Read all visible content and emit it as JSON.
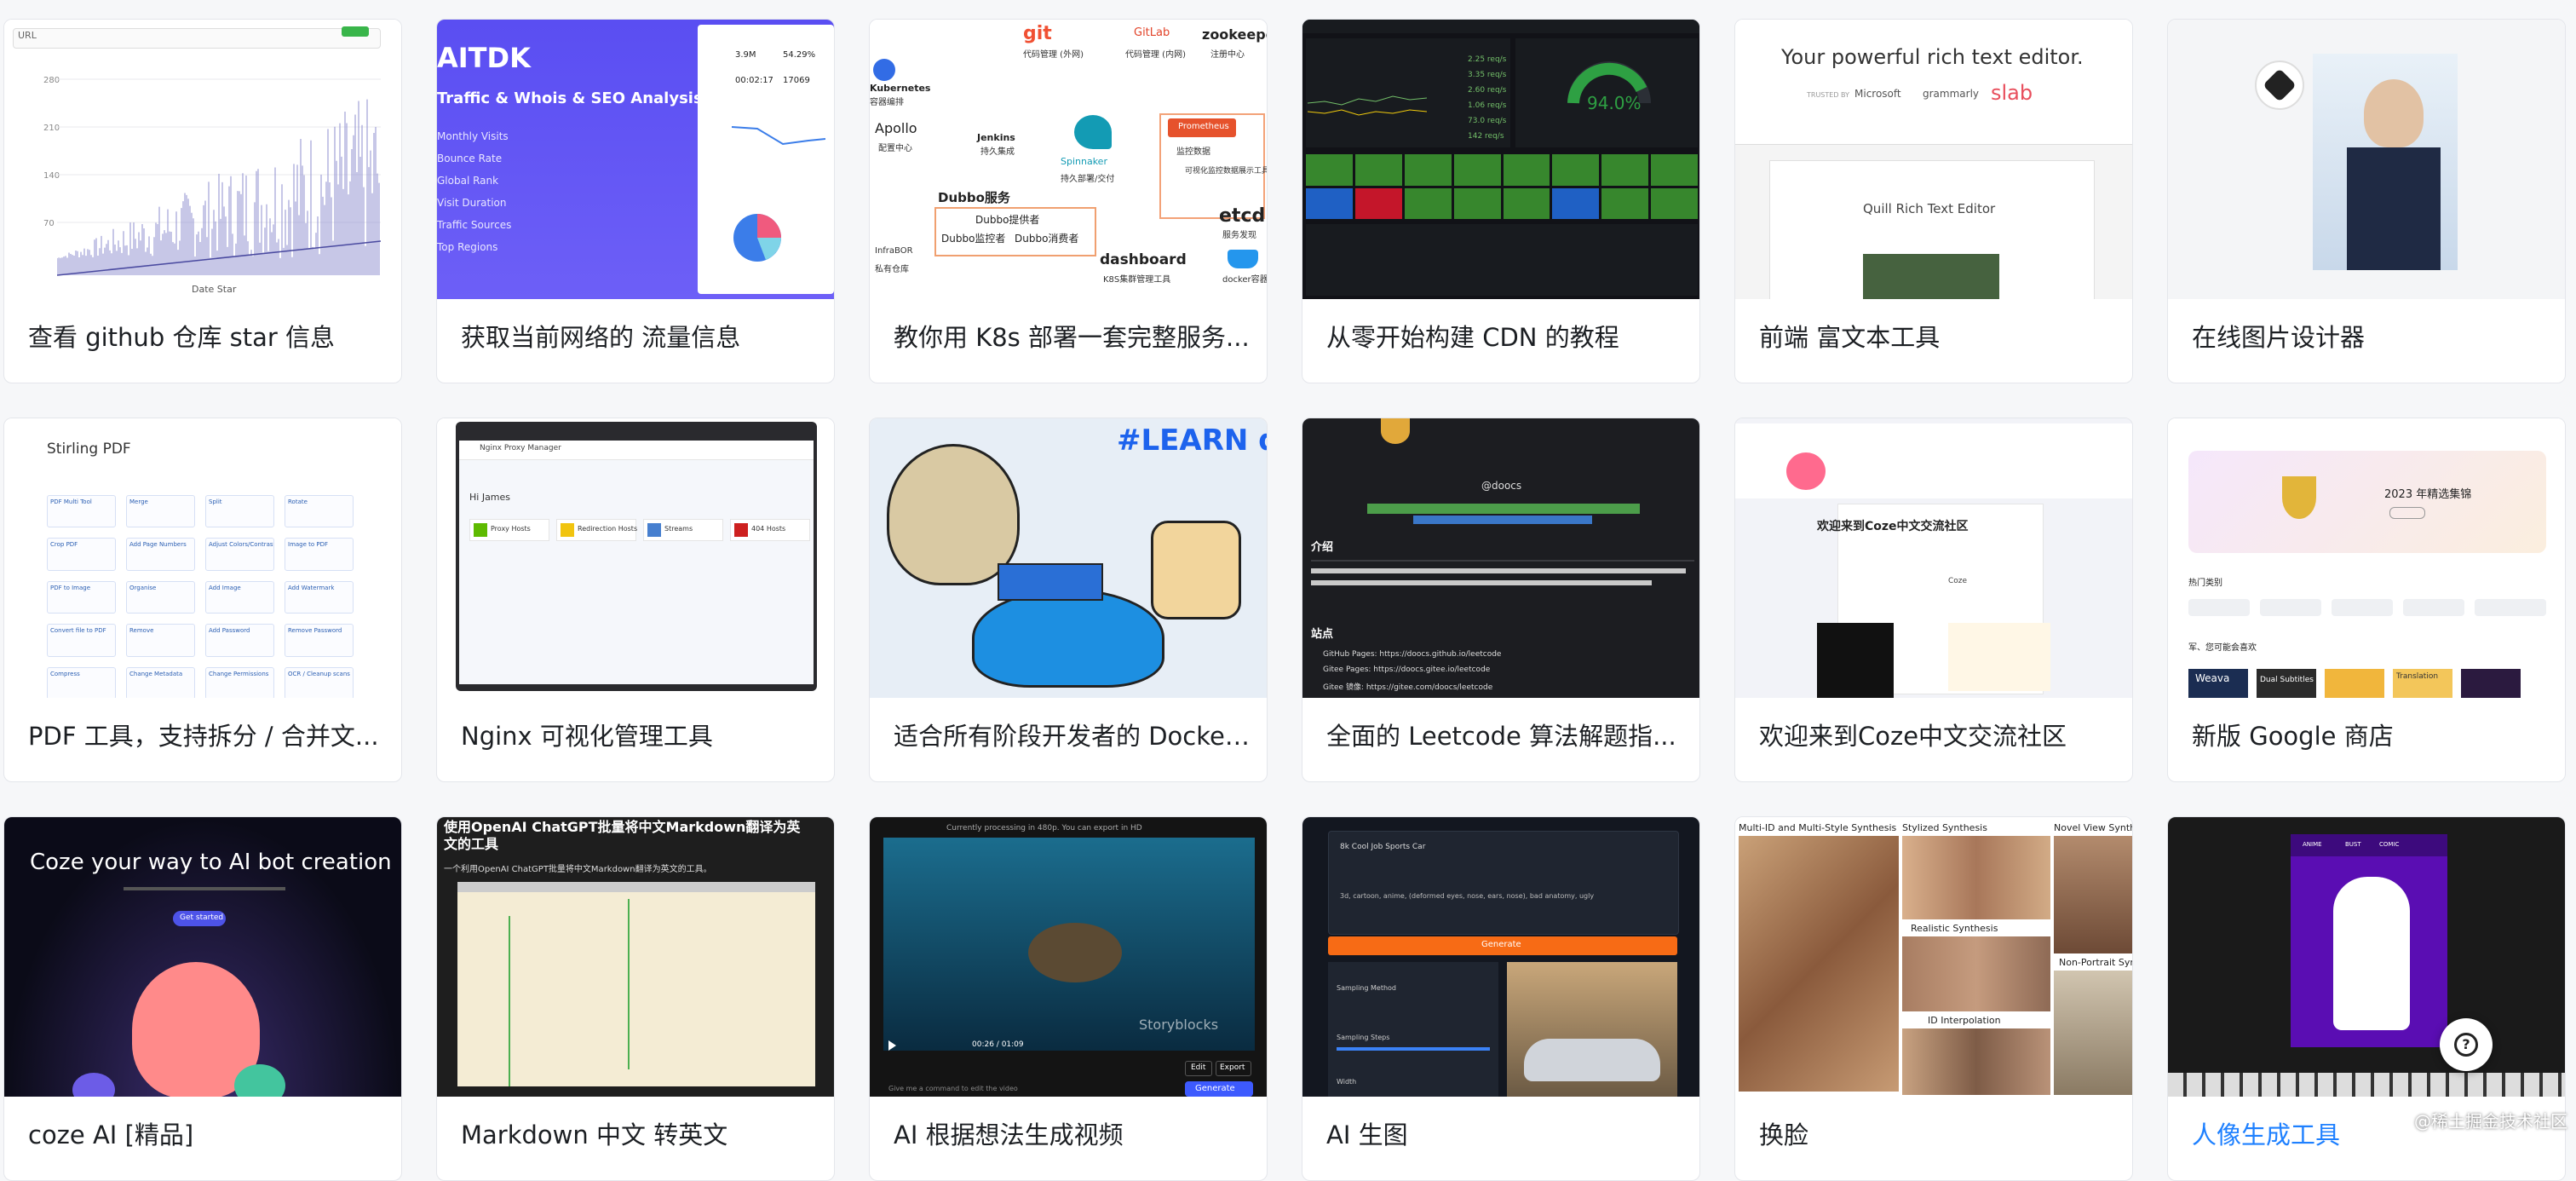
{
  "cards": [
    {
      "title": "查看 github 仓库 star 信息"
    },
    {
      "title": "获取当前网络的 流量信息"
    },
    {
      "title": "教你用 K8s 部署一套完整服务..."
    },
    {
      "title": "从零开始构建 CDN 的教程"
    },
    {
      "title": "前端 富文本工具"
    },
    {
      "title": "在线图片设计器"
    },
    {
      "title": "PDF 工具，支持拆分 / 合并文..."
    },
    {
      "title": "Nginx 可视化管理工具"
    },
    {
      "title": "适合所有阶段开发者的 Docker..."
    },
    {
      "title": "全面的 Leetcode 算法解题指..."
    },
    {
      "title": "欢迎来到Coze中文交流社区"
    },
    {
      "title": "新版 Google 商店"
    },
    {
      "title": "coze AI [精品]"
    },
    {
      "title": "Markdown 中文 转英文"
    },
    {
      "title": "AI 根据想法生成视频"
    },
    {
      "title": "AI 生图"
    },
    {
      "title": "换脸"
    },
    {
      "title": "人像生成工具"
    }
  ],
  "thumbs": {
    "github_star": {
      "url_label": "URL",
      "legend": "Date  Star",
      "y_ticks": [
        "280",
        "210",
        "140",
        "70"
      ]
    },
    "aitdk": {
      "brand": "AITDK",
      "heading": "Traffic & Whois & SEO Analysis",
      "menu": [
        "Monthly Visits",
        "Bounce Rate",
        "Global Rank",
        "Visit Duration",
        "Traffic Sources",
        "Top Regions"
      ],
      "stats": [
        "3.9M",
        "54.29%",
        "00:02:17",
        "17069"
      ]
    },
    "k8s": {
      "labels": [
        "git",
        "代码管理 (外网)",
        "GitLab",
        "代码管理 (内网)",
        "zookeeper",
        "注册中心",
        "Kubernetes",
        "容器编排",
        "Apollo",
        "配置中心",
        "Jenkins",
        "持久集成",
        "Spinnaker",
        "持久部署/交付",
        "Prometheus",
        "监控数据",
        "可视化监控数据展示工具",
        "Dubbo服务",
        "Dubbo提供者",
        "Dubbo监控者",
        "Dubbo消费者",
        "etcd",
        "服务发现",
        "dashboard",
        "K8S集群管理工具",
        "docker容器",
        "InfraBOR",
        "私有仓库"
      ]
    },
    "cdn": {
      "gauge_value": "94.0%",
      "rates": [
        "2.25 req/s",
        "3.35 req/s",
        "2.60 req/s",
        "1.06 req/s",
        "73.0 req/s",
        "142 req/s"
      ]
    },
    "quill": {
      "headline": "Your powerful rich text editor.",
      "trusted": "TRUSTED BY",
      "logos": [
        "Microsoft",
        "grammarly",
        "slab"
      ],
      "editor_title": "Quill Rich Text Editor"
    },
    "stirling": {
      "title": "Stirling PDF",
      "tiles": [
        "PDF Multi Tool",
        "Merge",
        "Split",
        "Rotate",
        "Crop PDF",
        "Add Page Numbers",
        "Adjust Colors/Contrast",
        "Image to PDF",
        "PDF to Image",
        "Organise",
        "Add Image",
        "Add Watermark",
        "Convert file to PDF",
        "Remove",
        "Add Password",
        "Remove Password",
        "Compress",
        "Change Metadata",
        "Change Permissions",
        "OCR / Cleanup scans"
      ]
    },
    "nginx": {
      "app": "Nginx Proxy Manager",
      "greeting": "Hi James",
      "stats": [
        "Proxy Hosts",
        "Redirection Hosts",
        "Streams",
        "404 Hosts"
      ]
    },
    "docker": {
      "hashtag": "#LEARN doc"
    },
    "leetcode": {
      "brand": "@doocs",
      "section_intro": "介绍",
      "section_sites": "站点",
      "links": [
        "GitHub Pages: https://doocs.github.io/leetcode",
        "Gitee Pages: https://doocs.gitee.io/leetcode",
        "Gitee 镜像: https://gitee.com/doocs/leetcode"
      ]
    },
    "coze_cn": {
      "heading": "欢迎来到Coze中文交流社区",
      "brand": "Coze"
    },
    "google_store": {
      "banner": "2023 年精选集锦",
      "section_hot": "热门类别",
      "section_rec": "军、您可能会喜欢",
      "apps": [
        "Weava",
        "Dual Subtitles",
        "",
        "Translation",
        ""
      ]
    },
    "coze_ai": {
      "headline": "Coze your way to AI bot creation",
      "cta": "Get started"
    },
    "markdown": {
      "title": "使用OpenAI ChatGPT批量将中文Markdown翻译为英文的工具",
      "subtitle": "一个利用OpenAI ChatGPT批量将中文Markdown翻译为英文的工具。"
    },
    "video": {
      "status": "Currently processing in 480p. You can export in HD",
      "time": "00:26 / 01:09",
      "buttons": [
        "Edit",
        "Export"
      ],
      "cta": "Generate",
      "prompt": "Give me a command to edit the video",
      "brand": "Storyblocks"
    },
    "ai_image": {
      "prompt": "8k Cool Job Sports Car",
      "negative": "3d, cartoon, anime, (deformed eyes, nose, ears, nose), bad anatomy, ugly",
      "generate": "Generate",
      "fields": [
        "Sampling Method",
        "Sampling Steps",
        "Width"
      ]
    },
    "faceswap": {
      "labels": [
        "Multi-ID and Multi-Style Synthesis",
        "Stylized Synthesis",
        "Novel View Synthesis",
        "Realistic Synthesis",
        "ID Interpolation",
        "Non-Portrait Synthesis"
      ]
    },
    "portrait": {
      "tabs": [
        "ANIME",
        "BUST",
        "COMIC"
      ]
    }
  },
  "watermark": "@稀土掘金技术社区",
  "colors": {
    "accent": "#1e80ff",
    "link": "#1e80ff"
  }
}
